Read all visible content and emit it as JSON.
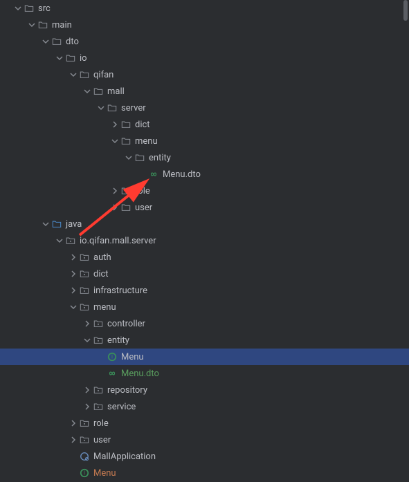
{
  "nodes": [
    {
      "depth": 0,
      "expanded": true,
      "type": "folder",
      "label": "src",
      "cls": ""
    },
    {
      "depth": 1,
      "expanded": true,
      "type": "folder",
      "label": "main",
      "cls": ""
    },
    {
      "depth": 2,
      "expanded": true,
      "type": "folder",
      "label": "dto",
      "cls": ""
    },
    {
      "depth": 3,
      "expanded": true,
      "type": "folder",
      "label": "io",
      "cls": ""
    },
    {
      "depth": 4,
      "expanded": true,
      "type": "folder",
      "label": "qifan",
      "cls": ""
    },
    {
      "depth": 5,
      "expanded": true,
      "type": "folder",
      "label": "mall",
      "cls": ""
    },
    {
      "depth": 6,
      "expanded": true,
      "type": "folder",
      "label": "server",
      "cls": ""
    },
    {
      "depth": 7,
      "expanded": false,
      "type": "folder",
      "label": "dict",
      "cls": ""
    },
    {
      "depth": 7,
      "expanded": true,
      "type": "folder",
      "label": "menu",
      "cls": ""
    },
    {
      "depth": 8,
      "expanded": true,
      "type": "folder",
      "label": "entity",
      "cls": ""
    },
    {
      "depth": 9,
      "expanded": null,
      "type": "infinity",
      "label": "Menu.dto",
      "cls": ""
    },
    {
      "depth": 7,
      "expanded": false,
      "type": "folder",
      "label": "role",
      "cls": ""
    },
    {
      "depth": 7,
      "expanded": false,
      "type": "folder",
      "label": "user",
      "cls": ""
    },
    {
      "depth": 2,
      "expanded": true,
      "type": "folder-blue",
      "label": "java",
      "cls": ""
    },
    {
      "depth": 3,
      "expanded": true,
      "type": "package",
      "label": "io.qifan.mall.server",
      "cls": ""
    },
    {
      "depth": 4,
      "expanded": false,
      "type": "package",
      "label": "auth",
      "cls": ""
    },
    {
      "depth": 4,
      "expanded": false,
      "type": "package",
      "label": "dict",
      "cls": ""
    },
    {
      "depth": 4,
      "expanded": false,
      "type": "package",
      "label": "infrastructure",
      "cls": ""
    },
    {
      "depth": 4,
      "expanded": true,
      "type": "package",
      "label": "menu",
      "cls": ""
    },
    {
      "depth": 5,
      "expanded": false,
      "type": "package",
      "label": "controller",
      "cls": ""
    },
    {
      "depth": 5,
      "expanded": true,
      "type": "package",
      "label": "entity",
      "cls": ""
    },
    {
      "depth": 6,
      "expanded": null,
      "type": "interface",
      "label": "Menu",
      "cls": "",
      "selected": true
    },
    {
      "depth": 6,
      "expanded": null,
      "type": "infinity",
      "label": "Menu.dto",
      "cls": "green"
    },
    {
      "depth": 5,
      "expanded": false,
      "type": "package",
      "label": "repository",
      "cls": ""
    },
    {
      "depth": 5,
      "expanded": false,
      "type": "package",
      "label": "service",
      "cls": ""
    },
    {
      "depth": 4,
      "expanded": false,
      "type": "package",
      "label": "role",
      "cls": ""
    },
    {
      "depth": 4,
      "expanded": false,
      "type": "package",
      "label": "user",
      "cls": ""
    },
    {
      "depth": 4,
      "expanded": null,
      "type": "kotlin",
      "label": "MallApplication",
      "cls": ""
    },
    {
      "depth": 4,
      "expanded": null,
      "type": "interface",
      "label": "Menu",
      "cls": "brown"
    }
  ],
  "indentUnit": 20,
  "baseIndent": 10
}
